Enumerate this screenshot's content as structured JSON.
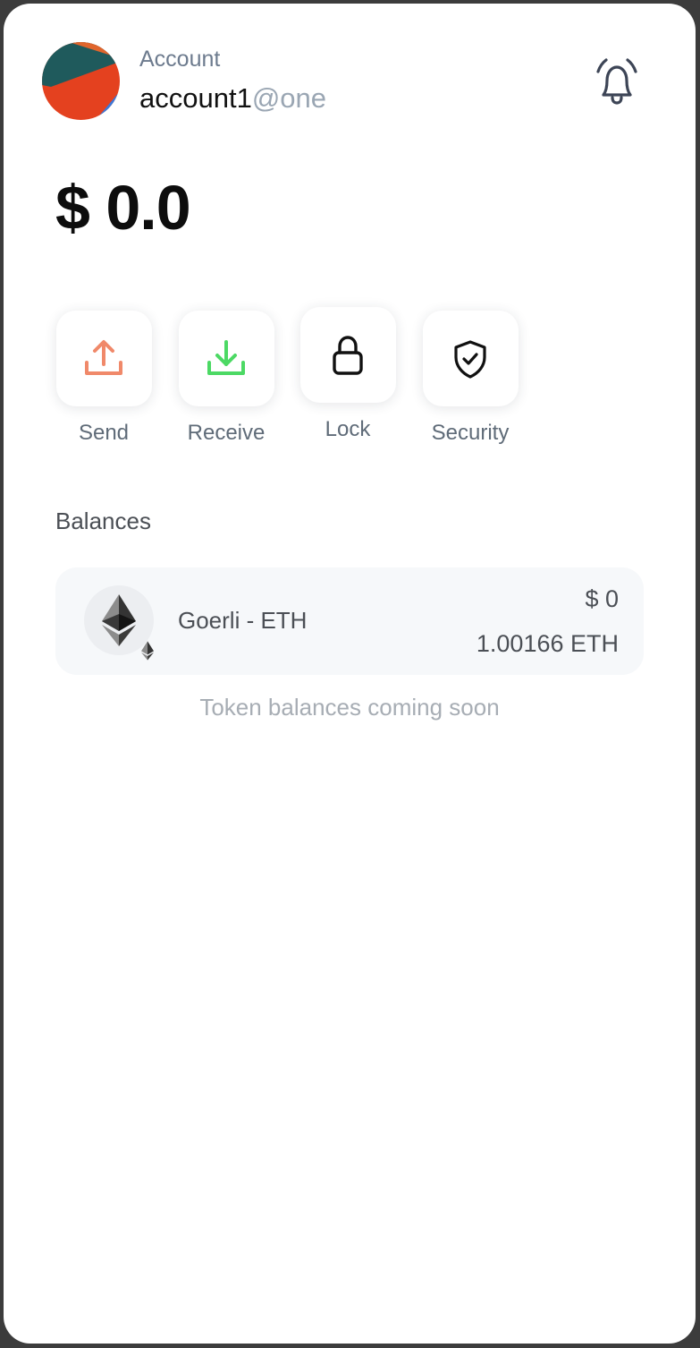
{
  "header": {
    "account_label": "Account",
    "account_name": "account1",
    "account_domain": "@one",
    "avatar_icon": "generated-avatar-icon",
    "notification_icon": "bell-icon"
  },
  "total_balance": "$ 0.0",
  "actions": [
    {
      "label": "Send",
      "icon": "upload-icon",
      "color": "#f0896a"
    },
    {
      "label": "Receive",
      "icon": "download-icon",
      "color": "#4cd964"
    },
    {
      "label": "Lock",
      "icon": "lock-icon",
      "color": "#111111"
    },
    {
      "label": "Security",
      "icon": "shield-check-icon",
      "color": "#111111"
    }
  ],
  "balances": {
    "title": "Balances",
    "tokens": [
      {
        "name": "Goerli - ETH",
        "usd_value": "$ 0",
        "amount": "1.00166 ETH",
        "icon": "ethereum-icon",
        "chain_icon": "ethereum-chain-icon"
      }
    ],
    "footer_note": "Token balances coming soon"
  }
}
